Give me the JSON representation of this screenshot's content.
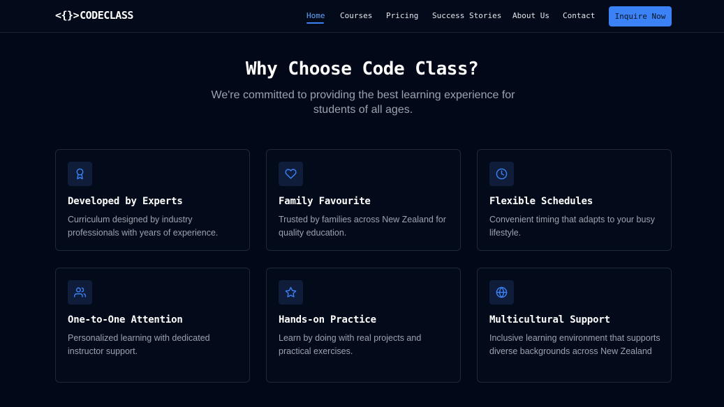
{
  "header": {
    "logo_glyph": "<{}>",
    "logo_text": "CODECLASS",
    "nav": [
      {
        "label": "Home",
        "active": true
      },
      {
        "label": "Courses",
        "active": false
      },
      {
        "label": "Pricing",
        "active": false
      },
      {
        "label": "Success Stories",
        "active": false
      },
      {
        "label": "About Us",
        "active": false
      },
      {
        "label": "Contact",
        "active": false
      }
    ],
    "cta_label": "Inquire Now"
  },
  "section": {
    "title": "Why Choose Code Class?",
    "subtitle": "We're committed to providing the best learning experience for students of all ages."
  },
  "features": [
    {
      "icon": "award-icon",
      "title": "Developed by Experts",
      "description": "Curriculum designed by industry professionals with years of experience."
    },
    {
      "icon": "heart-icon",
      "title": "Family Favourite",
      "description": "Trusted by families across New Zealand for quality education."
    },
    {
      "icon": "clock-icon",
      "title": "Flexible Schedules",
      "description": "Convenient timing that adapts to your busy lifestyle."
    },
    {
      "icon": "users-icon",
      "title": "One-to-One Attention",
      "description": "Personalized learning with dedicated instructor support."
    },
    {
      "icon": "star-icon",
      "title": "Hands-on Practice",
      "description": "Learn by doing with real projects and practical exercises."
    },
    {
      "icon": "globe-icon",
      "title": "Multicultural Support",
      "description": "Inclusive learning environment that supports diverse backgrounds across New Zealand"
    }
  ],
  "colors": {
    "background": "#020817",
    "accent": "#3b82f6",
    "icon": "#3b82f6"
  }
}
